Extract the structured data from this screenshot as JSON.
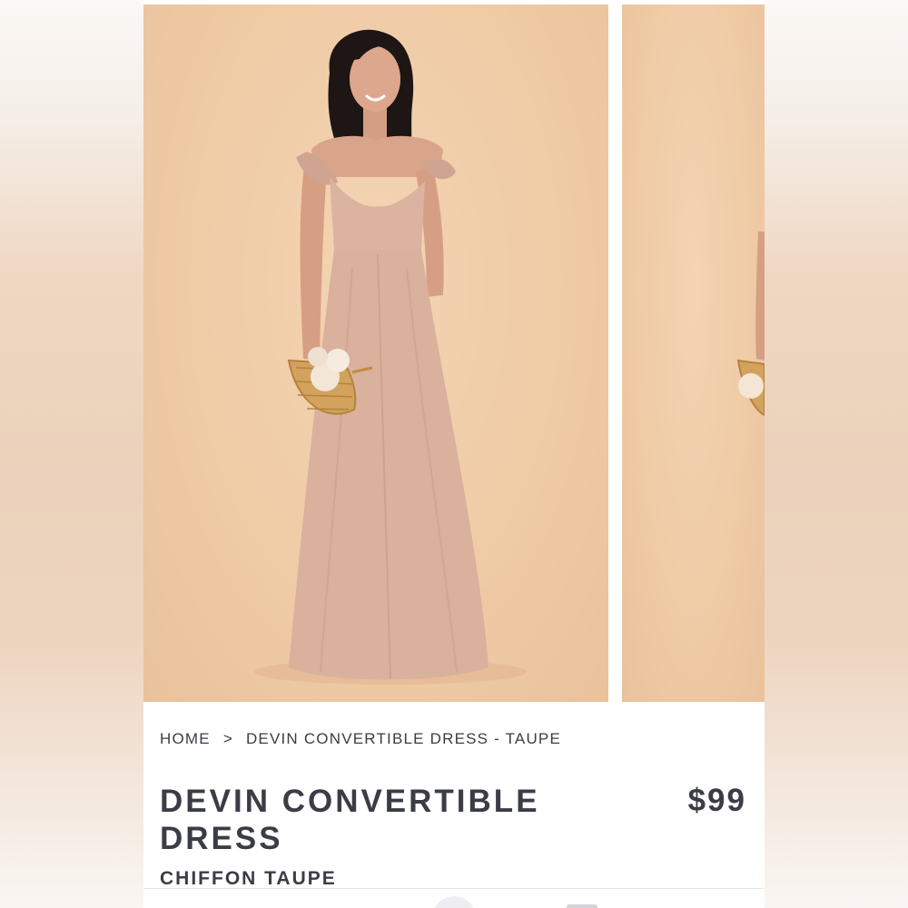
{
  "breadcrumb": {
    "home": "HOME",
    "separator": ">",
    "current": "DEVIN CONVERTIBLE DRESS - TAUPE"
  },
  "product": {
    "title": "DEVIN CONVERTIBLE DRESS",
    "price": "$99",
    "subtitle": "CHIFFON TAUPE"
  },
  "colors": {
    "background_peach": "#efcba6",
    "dress_taupe": "#d9b19c",
    "text_dark": "#3b3d46"
  },
  "icons": {
    "model_image": "product-photo",
    "model_image_2": "product-photo-partial"
  }
}
